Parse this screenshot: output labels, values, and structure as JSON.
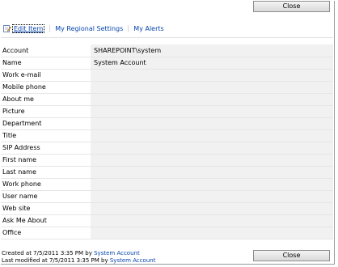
{
  "close_label": "Close",
  "toolbar": {
    "edit_item": "Edit Item",
    "regional_settings": "My Regional Settings",
    "alerts": "My Alerts"
  },
  "properties": [
    {
      "label": "Account",
      "value": "SHAREPOINT\\system"
    },
    {
      "label": "Name",
      "value": "System Account"
    },
    {
      "label": "Work e-mail",
      "value": ""
    },
    {
      "label": "Mobile phone",
      "value": ""
    },
    {
      "label": "About me",
      "value": ""
    },
    {
      "label": "Picture",
      "value": ""
    },
    {
      "label": "Department",
      "value": ""
    },
    {
      "label": "Title",
      "value": ""
    },
    {
      "label": "SIP Address",
      "value": ""
    },
    {
      "label": "First name",
      "value": ""
    },
    {
      "label": "Last name",
      "value": ""
    },
    {
      "label": "Work phone",
      "value": ""
    },
    {
      "label": "User name",
      "value": ""
    },
    {
      "label": "Web site",
      "value": ""
    },
    {
      "label": "Ask Me About",
      "value": ""
    },
    {
      "label": "Office",
      "value": ""
    }
  ],
  "footer": {
    "created_prefix": "Created at 7/5/2011 3:35 PM  by",
    "created_by": "System Account",
    "modified_prefix": "Last modified at 7/5/2011 3:35 PM  by",
    "modified_by": "System Account"
  },
  "colors": {
    "link": "#0645ad",
    "value_background": "#f1f1f1"
  }
}
